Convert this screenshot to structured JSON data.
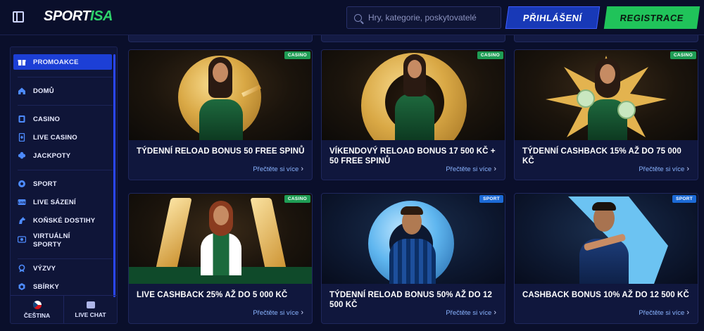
{
  "header": {
    "logo_part1": "SPORT",
    "logo_part2": "ISA",
    "search_placeholder": "Hry, kategorie, poskytovatelé",
    "login_label": "PŘIHLÁŠENÍ",
    "register_label": "REGISTRACE"
  },
  "sidebar": {
    "items": [
      {
        "label": "PROMOAKCE",
        "icon": "gift-icon"
      },
      {
        "label": "DOMŮ",
        "icon": "home-icon"
      },
      {
        "label": "CASINO",
        "icon": "casino-chip-icon"
      },
      {
        "label": "LIVE CASINO",
        "icon": "live-casino-icon"
      },
      {
        "label": "JACKPOTY",
        "icon": "clover-icon"
      },
      {
        "label": "SPORT",
        "icon": "ball-icon"
      },
      {
        "label": "LIVE SÁZENÍ",
        "icon": "live-icon"
      },
      {
        "label": "KOŇSKÉ DOSTIHY",
        "icon": "horse-icon"
      },
      {
        "label": "VIRTUÁLNÍ SPORTY",
        "icon": "virtual-icon"
      },
      {
        "label": "VÝZVY",
        "icon": "medal-icon"
      },
      {
        "label": "SBÍRKY",
        "icon": "collection-icon"
      }
    ],
    "language_label": "ČEŠTINA",
    "chat_label": "LIVE CHAT"
  },
  "cards": [
    {
      "badge": "CASINO",
      "title": "TÝDENNÍ RELOAD BONUS 50 FREE SPINŮ",
      "link": "Přečtěte si více"
    },
    {
      "badge": "CASINO",
      "title": "VÍKENDOVÝ RELOAD BONUS 17 500 KČ + 50 FREE SPINŮ",
      "link": "Přečtěte si více"
    },
    {
      "badge": "CASINO",
      "title": "TÝDENNÍ CASHBACK 15% AŽ DO 75 000 KČ",
      "link": "Přečtěte si více"
    },
    {
      "badge": "CASINO",
      "title": "LIVE CASHBACK 25% AŽ DO 5 000 KČ",
      "link": "Přečtěte si více"
    },
    {
      "badge": "SPORT",
      "title": "TÝDENNÍ RELOAD BONUS 50% AŽ DO 12 500 KČ",
      "link": "Přečtěte si více"
    },
    {
      "badge": "SPORT",
      "title": "CASHBACK BONUS 10% AŽ DO 12 500 KČ",
      "link": "Přečtěte si více"
    }
  ],
  "colors": {
    "background": "#0a0f2b",
    "accent_blue": "#1c3fd6",
    "accent_green": "#20c35a",
    "link": "#8ab4ff"
  }
}
